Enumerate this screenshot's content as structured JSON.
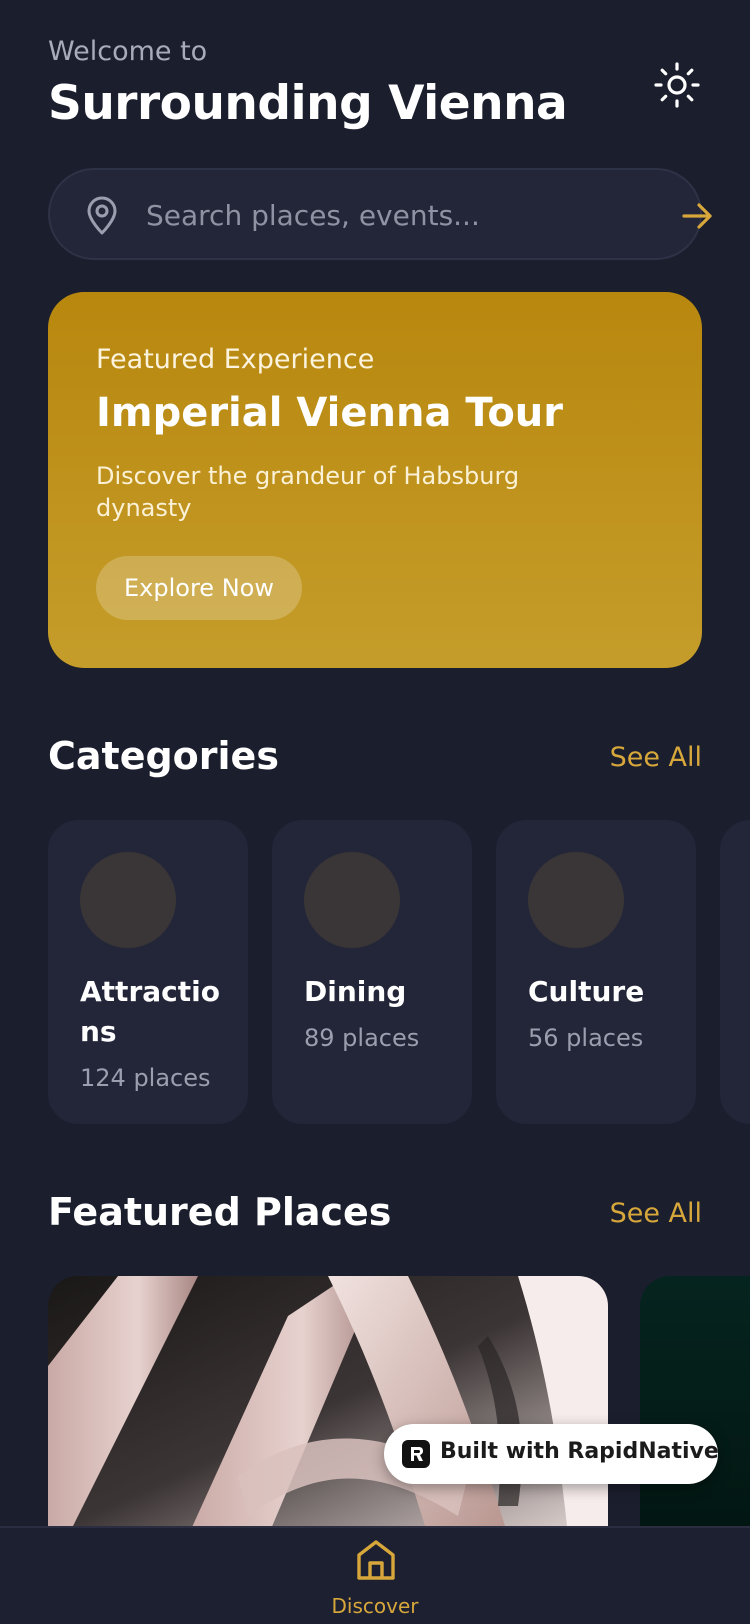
{
  "header": {
    "welcome": "Welcome to",
    "title": "Surrounding Vienna",
    "theme_toggle_icon": "sun-icon"
  },
  "search": {
    "placeholder": "Search places, events...",
    "value": "",
    "leading_icon": "map-pin-icon",
    "submit_icon": "arrow-right-icon"
  },
  "featured": {
    "kicker": "Featured Experience",
    "title": "Imperial Vienna Tour",
    "description": "Discover the grandeur of Habsburg dynasty",
    "button_label": "Explore Now"
  },
  "categories": {
    "title": "Categories",
    "see_all": "See All",
    "items": [
      {
        "name": "Attractions",
        "count": "124 places"
      },
      {
        "name": "Dining",
        "count": "89 places"
      },
      {
        "name": "Culture",
        "count": "56 places"
      }
    ]
  },
  "featured_places": {
    "title": "Featured Places",
    "see_all": "See All"
  },
  "badge": {
    "label": "Built with RapidNative"
  },
  "nav": {
    "items": [
      {
        "label": "Discover",
        "icon": "home-icon",
        "active": true
      }
    ]
  },
  "colors": {
    "background": "#1b1e2d",
    "surface": "#232638",
    "accent": "#d7a73b",
    "hero_gold": "#c59d2a"
  }
}
